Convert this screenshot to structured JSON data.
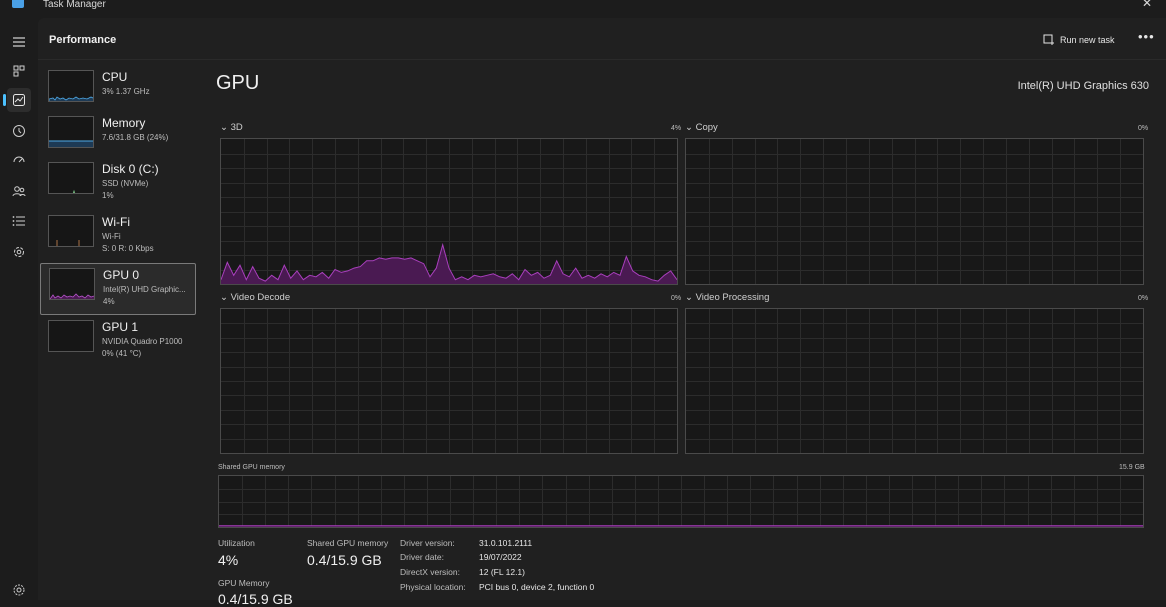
{
  "app": {
    "title": "Task Manager"
  },
  "header": {
    "title": "Performance",
    "run_new_task": "Run new task"
  },
  "devices": [
    {
      "name": "CPU",
      "line1": "3%  1.37 GHz",
      "line2": "",
      "color": "#4ea9e6"
    },
    {
      "name": "Memory",
      "line1": "7.6/31.8 GB (24%)",
      "line2": "",
      "color": "#4ea9e6"
    },
    {
      "name": "Disk 0 (C:)",
      "line1": "SSD (NVMe)",
      "line2": "1%",
      "color": "#7ec98a"
    },
    {
      "name": "Wi-Fi",
      "line1": "Wi-Fi",
      "line2": "S: 0 R: 0 Kbps",
      "color": "#d08a52"
    },
    {
      "name": "GPU 0",
      "line1": "Intel(R) UHD Graphic...",
      "line2": "4%",
      "color": "#b455c8"
    },
    {
      "name": "GPU 1",
      "line1": "NVIDIA Quadro P1000",
      "line2": "0% (41 °C)",
      "color": "#b455c8"
    }
  ],
  "gpu": {
    "title": "GPU",
    "model": "Intel(R) UHD Graphics 630",
    "engines": [
      {
        "label": "3D",
        "percent": "4%"
      },
      {
        "label": "Copy",
        "percent": "0%"
      },
      {
        "label": "Video Decode",
        "percent": "0%"
      },
      {
        "label": "Video Processing",
        "percent": "0%"
      }
    ],
    "shared_memory": {
      "label": "Shared GPU memory",
      "max": "15.9 GB"
    },
    "stats": {
      "utilization_label": "Utilization",
      "utilization": "4%",
      "shared_label": "Shared GPU memory",
      "shared": "0.4/15.9 GB",
      "gpu_memory_label": "GPU Memory",
      "gpu_memory": "0.4/15.9 GB"
    },
    "details": [
      {
        "key": "Driver version:",
        "value": "31.0.101.2111"
      },
      {
        "key": "Driver date:",
        "value": "19/07/2022"
      },
      {
        "key": "DirectX version:",
        "value": "12 (FL 12.1)"
      },
      {
        "key": "Physical location:",
        "value": "PCI bus 0, device 2, function 0"
      }
    ]
  },
  "colors": {
    "accent": "#4cc2ff",
    "gpu_line": "#a93fbd",
    "gpu_fill": "#4a1a52",
    "grid": "#2c2c2c"
  },
  "graph_3d_values": [
    3,
    15,
    6,
    13,
    3,
    12,
    4,
    2,
    6,
    3,
    13,
    4,
    9,
    3,
    6,
    5,
    8,
    4,
    10,
    8,
    9,
    11,
    12,
    16,
    16,
    18,
    17,
    18,
    18,
    17,
    18,
    16,
    14,
    5,
    11,
    27,
    11,
    3,
    5,
    3,
    6,
    5,
    6,
    7,
    5,
    4,
    7,
    3,
    10,
    6,
    8,
    4,
    6,
    16,
    7,
    5,
    11,
    4,
    6,
    4,
    7,
    5,
    8,
    6,
    19,
    9,
    6,
    5,
    3,
    2,
    6,
    9,
    3
  ]
}
